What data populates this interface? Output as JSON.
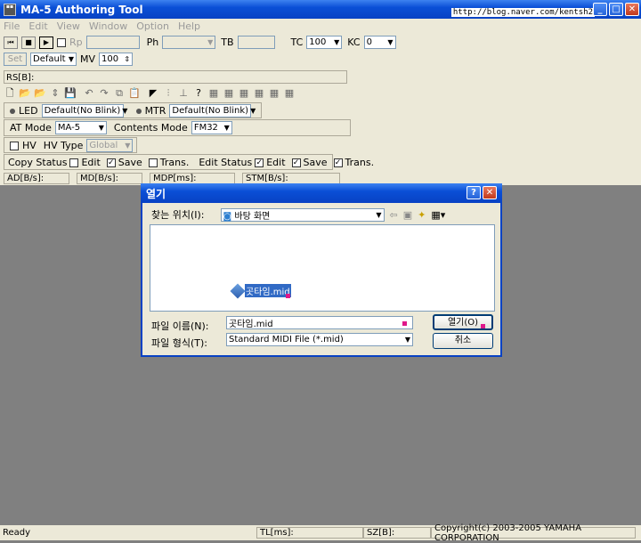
{
  "app": {
    "title": "MA-5 Authoring Tool",
    "title_overlay": "http://blog.naver.com/kentsh2"
  },
  "menu": [
    "File",
    "Edit",
    "View",
    "Window",
    "Option",
    "Help"
  ],
  "toolbar1": {
    "rp_label": "Rp",
    "ph_label": "Ph",
    "tb_label": "TB",
    "tc_label": "TC",
    "tc_value": "100",
    "kc_label": "KC",
    "kc_value": "0"
  },
  "toolbar2": {
    "set_label": "Set",
    "preset_value": "Default",
    "mv_label": "MV",
    "mv_value": "100"
  },
  "rs_label": "RS[B]:",
  "led": {
    "label": "LED",
    "value": "Default(No Blink)"
  },
  "mtr": {
    "label": "MTR",
    "value": "Default(No Blink)"
  },
  "at_mode": {
    "label": "AT Mode",
    "value": "MA-5"
  },
  "contents_mode": {
    "label": "Contents Mode",
    "value": "FM32"
  },
  "hv": {
    "label": "HV",
    "type_label": "HV Type",
    "type_value": "Global"
  },
  "copy_status": {
    "label": "Copy Status",
    "edit": "Edit",
    "save": "Save",
    "trans": "Trans."
  },
  "edit_status": {
    "label": "Edit Status",
    "edit": "Edit",
    "save": "Save",
    "trans": "Trans."
  },
  "info_fields": [
    "AD[B/s]:",
    "MD[B/s]:",
    "MDP[ms]:",
    "STM[B/s]:"
  ],
  "status": {
    "ready": "Ready",
    "tl": "TL[ms]:",
    "sz": "SZ[B]:",
    "copyright": "Copyright(c) 2003-2005 YAMAHA CORPORATION"
  },
  "dialog": {
    "title": "열기",
    "look_in_label": "찾는 위치(I):",
    "look_in_value": "바탕 화면",
    "file_item": "곳타임.mid",
    "filename_label": "파일 이름(N):",
    "filename_value": "곳타임.mid",
    "filetype_label": "파일 형식(T):",
    "filetype_value": "Standard MIDI File (*.mid)",
    "open_button": "열기(O)",
    "cancel_button": "취소"
  }
}
